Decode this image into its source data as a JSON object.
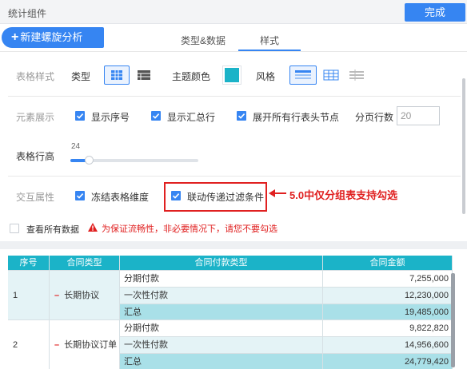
{
  "header": {
    "title": "统计组件",
    "done_label": "完成"
  },
  "new_button": {
    "label": "新建螺旋分析"
  },
  "tabs": [
    {
      "label": "类型&数据",
      "active": false
    },
    {
      "label": "样式",
      "active": true
    }
  ],
  "table_style": {
    "section_label": "表格样式",
    "type_label": "类型",
    "theme_color_label": "主题颜色",
    "theme_color": "#1bb3c8",
    "style_label": "风格"
  },
  "element_display": {
    "section_label": "元素展示",
    "show_index": "显示序号",
    "show_total_row": "显示汇总行",
    "expand_headers": "展开所有行表头节点",
    "page_rows_label": "分页行数",
    "page_rows_value": "20",
    "row_height_label": "表格行高",
    "row_height_value": "24"
  },
  "interaction": {
    "section_label": "交互属性",
    "freeze_dims": "冻结表格维度",
    "linked_filter": "联动传递过滤条件"
  },
  "annotation": "5.0中仅分组表支持勾选",
  "view_all": {
    "label": "查看所有数据",
    "warning": "为保证流畅性，非必要情况下，请您不要勾选"
  },
  "table": {
    "headers": [
      "序号",
      "合同类型",
      "合同付款类型",
      "合同金额"
    ],
    "groups": [
      {
        "index": "1",
        "type": "长期协议",
        "rows": [
          {
            "pay_type": "分期付款",
            "amount": "7,255,000"
          },
          {
            "pay_type": "一次性付款",
            "amount": "12,230,000"
          },
          {
            "pay_type": "汇总",
            "amount": "19,485,000"
          }
        ]
      },
      {
        "index": "2",
        "type": "长期协议订单",
        "rows": [
          {
            "pay_type": "分期付款",
            "amount": "9,822,820"
          },
          {
            "pay_type": "一次性付款",
            "amount": "14,956,600"
          },
          {
            "pay_type": "汇总",
            "amount": "24,779,420"
          }
        ]
      }
    ]
  },
  "colors": {
    "accent": "#3685f2",
    "theme": "#1bb3c8",
    "annotation": "#e02020"
  }
}
